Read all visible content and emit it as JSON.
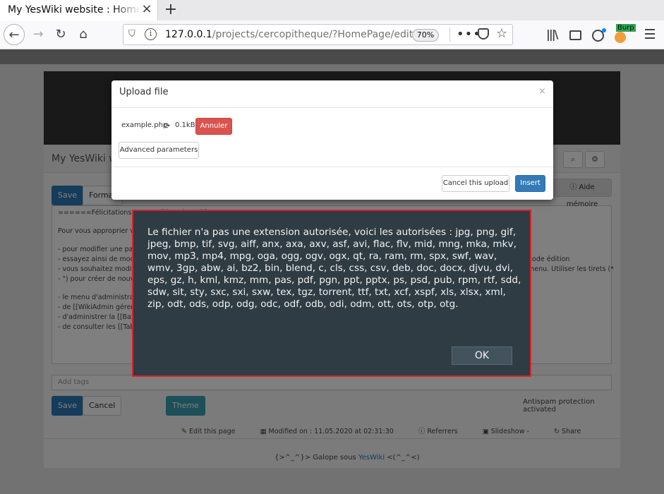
{
  "browser": {
    "tab_title": "My YesWiki website : HomePa",
    "url_host": "127.0.0.1",
    "url_path": "/projects/cercopitheque/?HomePage/edit",
    "zoom": "70%",
    "burp_label": "Burp"
  },
  "page": {
    "site_name": "My YesWiki we",
    "save_label": "Save",
    "format_label": "Format",
    "aide_label": "Aide mémoire",
    "editor_lines": [
      "======Félicitations, votre wiki est installé ! ======",
      "",
      "Pour vous approprier vo",
      "",
      " - pour modifier une page",
      "  - essayez ainsi de mod",
      "  - vous souhaitez modifi",
      " - \") pour créer de nouvel",
      "",
      " - le menu d'administratic",
      "  - de [[WikiAdmin gérer",
      "  - d'administrer la [[Baza",
      "  - de consulter les [[Tab"
    ],
    "editor_right_1": "node édition",
    "editor_right_2": "menu. Utiliser les tirets (*",
    "tags_placeholder": "Add tags",
    "cancel_label": "Cancel",
    "theme_label": "Theme",
    "antispam": "Antispam protection activated",
    "footer": {
      "edit": "Edit this page",
      "modified": "Modified on : 11.05.2020 at 02:31:30",
      "referrers": "Referrers",
      "slideshow": "Slideshow -",
      "share": "Share"
    },
    "galope_pre": "{>^_^}> Galope sous ",
    "galope_link": "YesWiki",
    "galope_post": " <(^_^<)"
  },
  "upload_modal": {
    "title": "Upload file",
    "close": "×",
    "filename": "example.php",
    "filesize": "0.1kB",
    "annuler": "Annuler",
    "advanced": "Advanced parameters",
    "cancel_upload": "Cancel this upload",
    "insert": "Insert"
  },
  "alert": {
    "message": "Le fichier n'a pas une extension autorisée, voici les autorisées : jpg, png, gif, jpeg, bmp, tif, svg, aiff, anx, axa, axv, asf, avi, flac, flv, mid, mng, mka, mkv, mov, mp3, mp4, mpg, oga, ogg, ogv, ogx, qt, ra, ram, rm, spx, swf, wav, wmv, 3gp, abw, ai, bz2, bin, blend, c, cls, css, csv, deb, doc, docx, djvu, dvi, eps, gz, h, kml, kmz, mm, pas, pdf, pgn, ppt, pptx, ps, psd, pub, rpm, rtf, sdd, sdw, sit, sty, sxc, sxi, sxw, tex, tgz, torrent, ttf, txt, xcf, xspf, xls, xlsx, xml, zip, odt, ods, odp, odg, odc, odf, odb, odi, odm, ott, ots, otp, otg.",
    "ok": "OK"
  }
}
